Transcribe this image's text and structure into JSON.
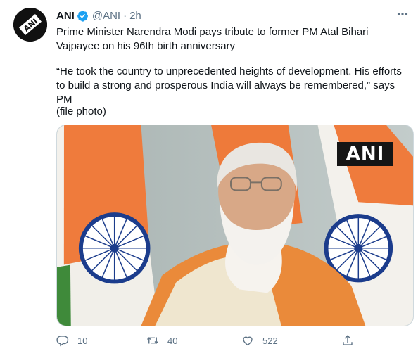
{
  "tweet": {
    "author_name": "ANI",
    "handle": "@ANI",
    "separator": "·",
    "time": "2h",
    "text_p1": "Prime Minister Narendra Modi pays tribute to former PM Atal Bihari Vajpayee on his 96th birth anniversary",
    "text_p2": "“He took the country to unprecedented heights of development. His efforts to build a strong and prosperous India will always be remembered,” says PM",
    "text_p3": "(file photo)",
    "media_watermark": "ANI",
    "avatar_logo_text": "ANI"
  },
  "actions": {
    "reply_count": "10",
    "retweet_count": "40",
    "like_count": "522"
  },
  "icons": {
    "verified": "verified-badge-icon",
    "more": "more-options-icon",
    "reply": "reply-icon",
    "retweet": "retweet-icon",
    "like": "heart-icon",
    "share": "share-icon"
  },
  "colors": {
    "verified_blue": "#1da1f2",
    "secondary_text": "#5b7083",
    "primary_text": "#0f1419"
  }
}
